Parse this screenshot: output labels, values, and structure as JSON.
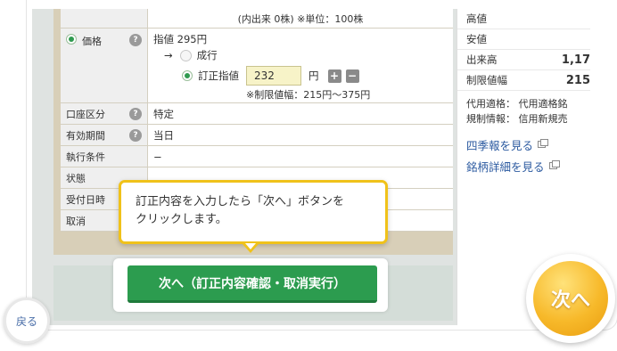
{
  "order": {
    "header_note": "(内出来 0株) ※単位：100株",
    "price": {
      "label": "価格",
      "limit_text": "指値 295円",
      "arrow": "→",
      "market_label": "成行",
      "correct_label": "訂正指値",
      "correct_value": "232",
      "unit": "円",
      "plus": "+",
      "minus": "−",
      "range_note": "※制限値幅：215円〜375円"
    },
    "rows": [
      {
        "label": "口座区分",
        "value": "特定",
        "help": true
      },
      {
        "label": "有効期間",
        "value": "当日",
        "help": true
      },
      {
        "label": "執行条件",
        "value": "−",
        "help": false
      },
      {
        "label": "状態",
        "value": "",
        "help": false
      },
      {
        "label": "受付日時",
        "value": "",
        "help": false
      },
      {
        "label": "取消",
        "value": "",
        "help": false
      }
    ],
    "help_glyph": "?"
  },
  "side": {
    "rows": [
      {
        "label": "高値",
        "value": ""
      },
      {
        "label": "安値",
        "value": ""
      },
      {
        "label": "出来高",
        "value": "1,17"
      },
      {
        "label": "制限値幅",
        "value": "215"
      }
    ],
    "info_lines": [
      "代用適格： 代用適格銘",
      "規制情報： 信用新規売"
    ],
    "links": [
      "四季報を見る",
      "銘柄詳細を見る"
    ]
  },
  "callout": {
    "line1": "訂正内容を入力したら「次へ」ボタンを",
    "line2": "クリックします。"
  },
  "next_button_label": "次へ（訂正内容確認・取消実行）",
  "back_label": "戻る",
  "next_circle_label": "次へ",
  "colors": {
    "accent_green": "#2c9c4f",
    "callout_border": "#f0c21a",
    "link_blue": "#2c5aa0"
  }
}
